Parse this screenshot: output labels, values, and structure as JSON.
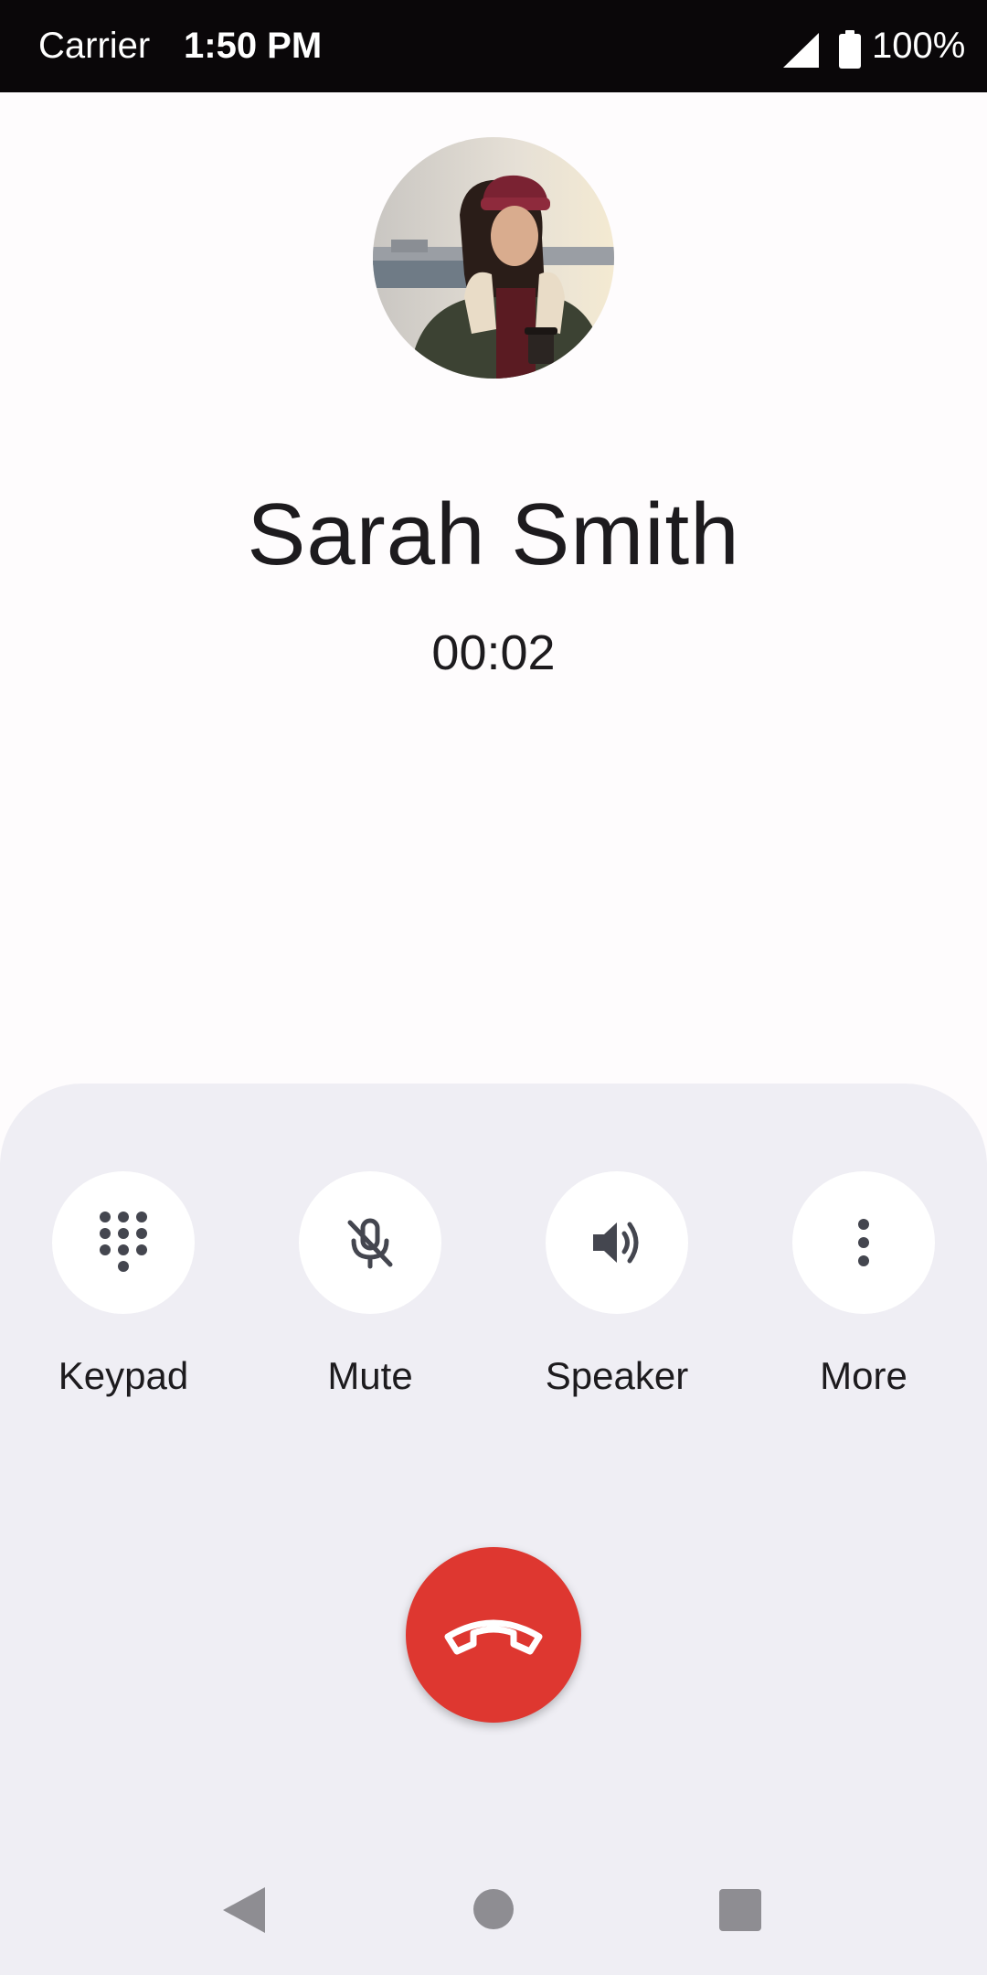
{
  "status_bar": {
    "carrier": "Carrier",
    "time": "1:50 PM",
    "battery": "100%",
    "signal_icon": "cell-signal-icon",
    "battery_icon": "battery-full-icon"
  },
  "call": {
    "caller_name": "Sarah Smith",
    "timer": "00:02",
    "avatar": "caller-photo"
  },
  "controls": [
    {
      "label": "Keypad",
      "icon": "dialpad-icon"
    },
    {
      "label": "Mute",
      "icon": "mic-off-icon"
    },
    {
      "label": "Speaker",
      "icon": "volume-icon"
    },
    {
      "label": "More",
      "icon": "more-vert-icon"
    }
  ],
  "end_call": {
    "icon": "call-end-icon",
    "color": "#de3730"
  },
  "nav": {
    "back": "back-icon",
    "home": "home-icon",
    "recents": "recents-icon"
  },
  "colors": {
    "background": "#fefcfd",
    "sheet": "#efeef4",
    "status_bar": "#0a0709",
    "end_call": "#de3730",
    "icon": "#44464f"
  }
}
